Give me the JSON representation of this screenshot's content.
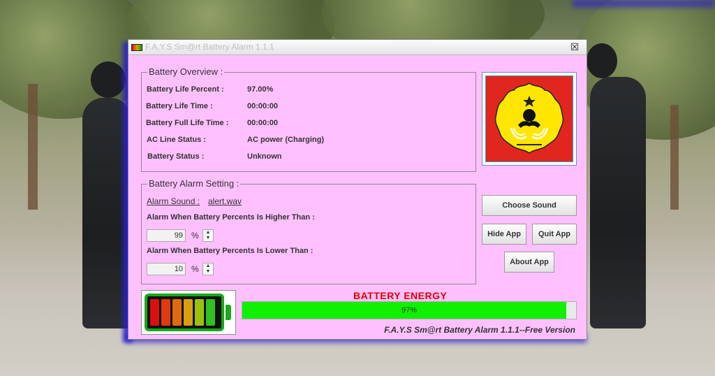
{
  "window": {
    "title": "F.A.Y.S Sm@rt Battery Alarm 1.1.1",
    "close_glyph": "☒"
  },
  "overview": {
    "title": "Battery Overview :",
    "rows": [
      {
        "label": "Battery Life Percent :",
        "value": "97.00%"
      },
      {
        "label": "Battery Life Time :",
        "value": "00:00:00"
      },
      {
        "label": "Battery Full Life Time :",
        "value": "00:00:00"
      },
      {
        "label": "AC Line Status :",
        "value": "AC power (Charging)"
      },
      {
        "label": "Battery Status :",
        "value": "Unknown"
      }
    ]
  },
  "alarm": {
    "title": "Battery Alarm Setting :",
    "sound_label": "Alarm Sound :",
    "sound_file": "alert.wav",
    "higher_label": "Alarm When Battery Percents Is Higher Than :",
    "higher_value": "99",
    "lower_label": "Alarm When Battery Percents Is Lower Than :",
    "lower_value": "10",
    "percent_sign": "%"
  },
  "buttons": {
    "choose_sound": "Choose Sound",
    "hide_app": "Hide App",
    "quit_app": "Quit App",
    "about_app": "About App"
  },
  "energy": {
    "title": "BATTERY ENERGY",
    "percent_text": "97%",
    "percent": 97
  },
  "version_text": "F.A.Y.S Sm@rt Battery Alarm 1.1.1--Free Version",
  "colors": {
    "window_bg": "#ffc0ff",
    "progress_fill": "#10f000",
    "energy_title": "#e00000",
    "logo_bg": "#e0261f",
    "logo_emblem": "#ffe600"
  }
}
